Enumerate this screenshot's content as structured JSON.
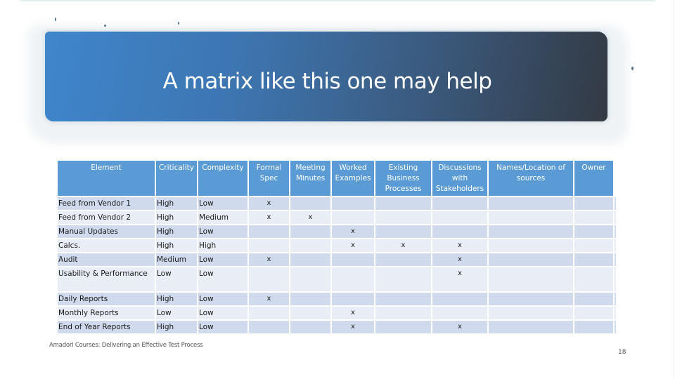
{
  "slide": {
    "title": "A matrix like this one may help",
    "footer": "Amadori Courses: Delivering an Effective Test Process",
    "page_number": "18"
  },
  "colors": {
    "header_blue": "#5b9bd5",
    "row_dark": "#cfdaec",
    "row_light": "#e8edf6",
    "banner_start": "#3f86cc",
    "banner_end": "#333a44"
  },
  "matrix": {
    "headers": [
      "Element",
      "Criticality",
      "Complexity",
      "Formal Spec",
      "Meeting Minutes",
      "Worked Examples",
      "Existing Business Processes",
      "Discussions with Stakeholders",
      "Names/Location of sources",
      "Owner"
    ],
    "rows": [
      {
        "element": "Feed from Vendor 1",
        "criticality": "High",
        "complexity": "Low",
        "marks": [
          "x",
          "",
          "",
          "",
          "",
          "",
          ""
        ]
      },
      {
        "element": "Feed from Vendor 2",
        "criticality": "High",
        "complexity": "Medium",
        "marks": [
          "x",
          "x",
          "",
          "",
          "",
          "",
          ""
        ]
      },
      {
        "element": "Manual Updates",
        "criticality": "High",
        "complexity": "Low",
        "marks": [
          "",
          "",
          "x",
          "",
          "",
          "",
          ""
        ]
      },
      {
        "element": "Calcs.",
        "criticality": "High",
        "complexity": "High",
        "marks": [
          "",
          "",
          "x",
          "x",
          "x",
          "",
          ""
        ]
      },
      {
        "element": "Audit",
        "criticality": "Medium",
        "complexity": "Low",
        "marks": [
          "x",
          "",
          "",
          "",
          "x",
          "",
          ""
        ]
      },
      {
        "element": "Usability & Performance",
        "criticality": "Low",
        "complexity": "Low",
        "marks": [
          "",
          "",
          "",
          "",
          "x",
          "",
          ""
        ]
      },
      {
        "element": "Daily Reports",
        "criticality": "High",
        "complexity": "Low",
        "marks": [
          "x",
          "",
          "",
          "",
          "",
          "",
          ""
        ]
      },
      {
        "element": "Monthly Reports",
        "criticality": "Low",
        "complexity": "Low",
        "marks": [
          "",
          "",
          "x",
          "",
          "",
          "",
          ""
        ]
      },
      {
        "element": "End of Year Reports",
        "criticality": "High",
        "complexity": "Low",
        "marks": [
          "",
          "",
          "x",
          "",
          "x",
          "",
          ""
        ]
      }
    ]
  }
}
